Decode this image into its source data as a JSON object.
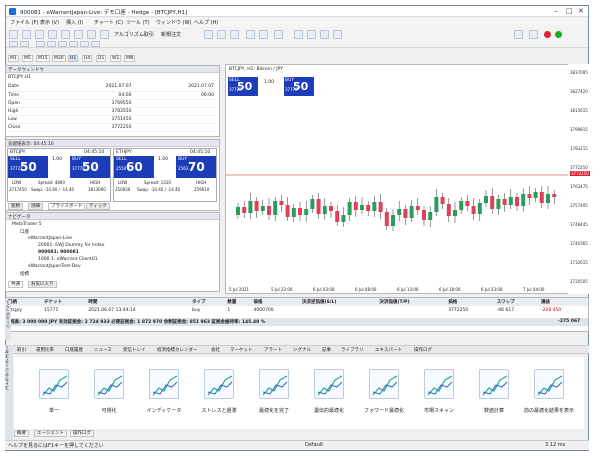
{
  "window": {
    "title": "900081 - eWarrantJapan-Live: デモ口座 - Hedge - [BTCJPY,H1]"
  },
  "menu": [
    "ファイル (F)",
    "表示 (V)",
    "挿入 (I)",
    "チャート (C)",
    "ツール (T)",
    "ウィンドウ (W)",
    "ヘルプ (H)"
  ],
  "toolbar": {
    "algo_label": "アルゴリズム取引",
    "new_order_label": "新規注文"
  },
  "timeframes": [
    "M1",
    "M5",
    "M15",
    "M30",
    "H1",
    "H4",
    "D1",
    "W1",
    "MN"
  ],
  "data_window": {
    "title": "データウィンドウ",
    "symbol": "BTCJPY,H1",
    "rows": [
      [
        "Date",
        "2021.07.07",
        "2021.07.07"
      ],
      [
        "Time",
        "04:00",
        "06:00"
      ],
      [
        "Open",
        "3769550",
        ""
      ],
      [
        "High",
        "3783550",
        ""
      ],
      [
        "Low",
        "3751450",
        ""
      ],
      [
        "Close",
        "3772250",
        ""
      ]
    ]
  },
  "market_watch": {
    "title": "気配値表示: 04:45:10",
    "cards": [
      {
        "symbol": "BTCJPY",
        "time": "04:45:10",
        "sell": "SELL",
        "buy": "BUY",
        "lot": "1.00",
        "sell_small": "37722",
        "sell_big": "50",
        "buy_small": "37770",
        "buy_big": "50",
        "low_label": "LOW",
        "spread": "Spread: 4800",
        "high_label": "HIGH",
        "low": "3717450",
        "swap": "Swap: -14.40 / -14.40",
        "high": "3813000"
      },
      {
        "symbol": "ETHJPY",
        "time": "04:45:10",
        "sell": "SELL",
        "buy": "BUY",
        "lot": "1.00",
        "sell_small": "2550",
        "sell_big": "60",
        "buy_small": "2563",
        "buy_big": "70",
        "low_label": "LOW",
        "spread": "Spread: 1310",
        "high_label": "HIGH",
        "low": "250930",
        "swap": "Swap: -14.40 / -14.40",
        "high": "259610"
      }
    ],
    "tabs": [
      "銘柄",
      "詳細",
      "プライスボード",
      "ティック"
    ]
  },
  "navigator": {
    "title": "ナビゲータ",
    "items": [
      "MetaTrader 5",
      "口座",
      "eWarrantJapan-Live",
      "20001: EWJ Dummy for Index",
      "900081: 900081",
      "1000 1: eWarrant Client01",
      "eWarrantJapanTest-Dev",
      "指標"
    ],
    "tabs": [
      "共通",
      "お気に入り"
    ]
  },
  "chart": {
    "header": "BTCJPY, H1: Bitcoin / JPY",
    "lot": "1.00",
    "sell": "SELL",
    "buy": "BUY",
    "sell_small": "37722",
    "sell_big": "50",
    "buy_small": "37770",
    "buy_big": "50",
    "price_labels": [
      "3837095",
      "3827420",
      "3815615",
      "3799815",
      "3783215",
      "3772250",
      "3763475",
      "3757405",
      "3748445",
      "3740365",
      "3732615",
      "3720505"
    ],
    "time_labels": [
      "5 Jul 2021",
      "5 Jul 22:00",
      "6 Jul 03:00",
      "6 Jul 08:00",
      "6 Jul 13:00",
      "6 Jul 18:00",
      "6 Jul 23:00",
      "7 Jul 04:00"
    ],
    "last_price": "3772250"
  },
  "trades": {
    "headers": [
      "銘柄",
      "チケット",
      "時間",
      "タイプ",
      "数量",
      "価格",
      "決済逆指値(S/L)",
      "決済指値(T/P)",
      "価格",
      "スワップ",
      "損益"
    ],
    "row": [
      "btcjpy",
      "15771",
      "2021.06.07 13:44:14",
      "buy",
      "1",
      "4000700",
      "",
      "",
      "3772250",
      "-46 617",
      "-228 450"
    ],
    "balance": "残高: 3 000 000 JPY  有効証拠金: 2 724 933  必要証拠金: 1 872 970  余剰証拠金: 851 963  証拠金維持率: 145.49 %",
    "balance_pl": "-275 067"
  },
  "bottom_tabs": [
    "取引",
    "運用比率",
    "口座履歴",
    "ニュース",
    "受信トレイ",
    "経済指標カレンダー",
    "会社",
    "マーケット",
    "アラート",
    "シグナル",
    "記事",
    "ライブラリ",
    "エキスパート",
    "操作ログ"
  ],
  "strategy_side": "ストラテジーテスター",
  "toolbox_side": "ツールボックス",
  "strategies": [
    {
      "label": "単一"
    },
    {
      "label": "可視化"
    },
    {
      "label": "インディケータ"
    },
    {
      "label": "ストレスと遅滞"
    },
    {
      "label": "最適化を完了"
    },
    {
      "label": "遺伝的最適化"
    },
    {
      "label": "フォワード最適化"
    },
    {
      "label": "市場スキャン"
    },
    {
      "label": "数値計算"
    },
    {
      "label": "前の最適化結果を表示"
    }
  ],
  "strategy_tabs": [
    "概要",
    "エージェント",
    "操作ログ"
  ],
  "status": {
    "help": "ヘルプを見るにはF1キーを押してください",
    "profile": "Default",
    "size": "3.12 ms"
  }
}
